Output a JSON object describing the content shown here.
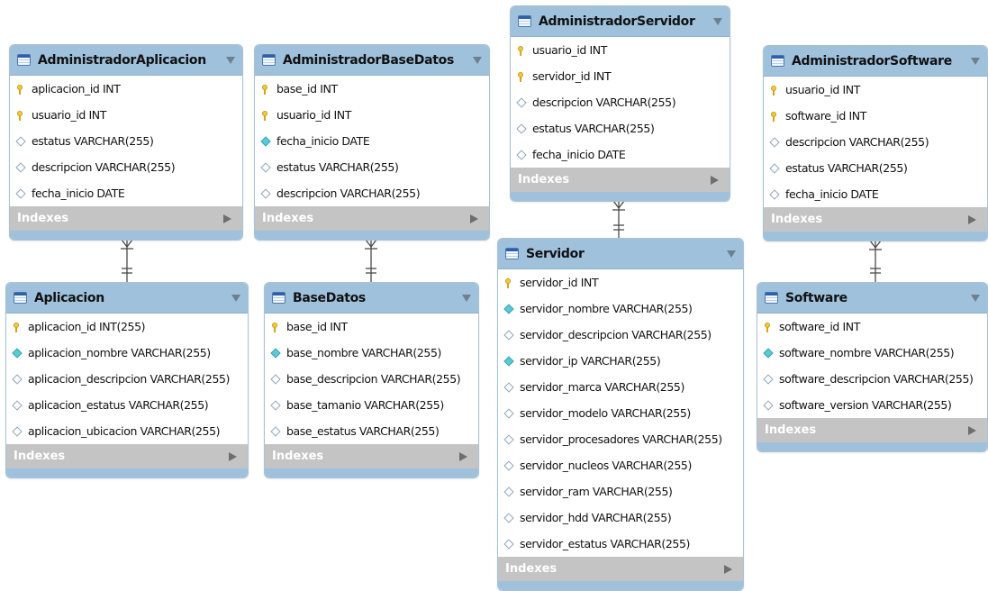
{
  "diagram": {
    "indexes_label": "Indexes",
    "colors": {
      "header": "#9fc1dc",
      "indexes_bar": "#c4c4c4",
      "pk_key": "#f2cc3a",
      "nn_diamond": "#5ec9d6",
      "connector": "#4a4a4a"
    },
    "tables": [
      {
        "name": "AdministradorAplicacion",
        "columns": [
          {
            "icon": "key-icon",
            "text": "aplicacion_id INT"
          },
          {
            "icon": "key-icon",
            "text": "usuario_id INT"
          },
          {
            "icon": "empty-diamond-icon",
            "text": "estatus VARCHAR(255)"
          },
          {
            "icon": "empty-diamond-icon",
            "text": "descripcion VARCHAR(255)"
          },
          {
            "icon": "empty-diamond-icon",
            "text": "fecha_inicio DATE"
          }
        ]
      },
      {
        "name": "AdministradorBaseDatos",
        "columns": [
          {
            "icon": "key-icon",
            "text": "base_id INT"
          },
          {
            "icon": "key-icon",
            "text": "usuario_id INT"
          },
          {
            "icon": "filled-diamond-icon",
            "text": "fecha_inicio DATE"
          },
          {
            "icon": "empty-diamond-icon",
            "text": "estatus VARCHAR(255)"
          },
          {
            "icon": "empty-diamond-icon",
            "text": "descripcion VARCHAR(255)"
          }
        ]
      },
      {
        "name": "AdministradorServidor",
        "columns": [
          {
            "icon": "key-icon",
            "text": "usuario_id INT"
          },
          {
            "icon": "key-icon",
            "text": "servidor_id INT"
          },
          {
            "icon": "empty-diamond-icon",
            "text": "descripcion VARCHAR(255)"
          },
          {
            "icon": "empty-diamond-icon",
            "text": "estatus VARCHAR(255)"
          },
          {
            "icon": "empty-diamond-icon",
            "text": "fecha_inicio DATE"
          }
        ]
      },
      {
        "name": "AdministradorSoftware",
        "columns": [
          {
            "icon": "key-icon",
            "text": "usuario_id INT"
          },
          {
            "icon": "key-icon",
            "text": "software_id INT"
          },
          {
            "icon": "empty-diamond-icon",
            "text": "descripcion VARCHAR(255)"
          },
          {
            "icon": "empty-diamond-icon",
            "text": "estatus VARCHAR(255)"
          },
          {
            "icon": "empty-diamond-icon",
            "text": "fecha_inicio DATE"
          }
        ]
      },
      {
        "name": "Aplicacion",
        "columns": [
          {
            "icon": "key-icon",
            "text": "aplicacion_id INT(255)"
          },
          {
            "icon": "filled-diamond-icon",
            "text": "aplicacion_nombre VARCHAR(255)"
          },
          {
            "icon": "empty-diamond-icon",
            "text": "aplicacion_descripcion VARCHAR(255)"
          },
          {
            "icon": "empty-diamond-icon",
            "text": "aplicacion_estatus VARCHAR(255)"
          },
          {
            "icon": "empty-diamond-icon",
            "text": "aplicacion_ubicacion VARCHAR(255)"
          }
        ]
      },
      {
        "name": "BaseDatos",
        "columns": [
          {
            "icon": "key-icon",
            "text": "base_id INT"
          },
          {
            "icon": "filled-diamond-icon",
            "text": "base_nombre VARCHAR(255)"
          },
          {
            "icon": "empty-diamond-icon",
            "text": "base_descripcion VARCHAR(255)"
          },
          {
            "icon": "empty-diamond-icon",
            "text": "base_tamanio VARCHAR(255)"
          },
          {
            "icon": "empty-diamond-icon",
            "text": "base_estatus VARCHAR(255)"
          }
        ]
      },
      {
        "name": "Servidor",
        "columns": [
          {
            "icon": "key-icon",
            "text": "servidor_id INT"
          },
          {
            "icon": "filled-diamond-icon",
            "text": "servidor_nombre VARCHAR(255)"
          },
          {
            "icon": "empty-diamond-icon",
            "text": "servidor_descripcion VARCHAR(255)"
          },
          {
            "icon": "filled-diamond-icon",
            "text": "servidor_ip VARCHAR(255)"
          },
          {
            "icon": "empty-diamond-icon",
            "text": "servidor_marca VARCHAR(255)"
          },
          {
            "icon": "empty-diamond-icon",
            "text": "servidor_modelo VARCHAR(255)"
          },
          {
            "icon": "empty-diamond-icon",
            "text": "servidor_procesadores VARCHAR(255)"
          },
          {
            "icon": "empty-diamond-icon",
            "text": "servidor_nucleos VARCHAR(255)"
          },
          {
            "icon": "empty-diamond-icon",
            "text": "servidor_ram VARCHAR(255)"
          },
          {
            "icon": "empty-diamond-icon",
            "text": "servidor_hdd VARCHAR(255)"
          },
          {
            "icon": "empty-diamond-icon",
            "text": "servidor_estatus VARCHAR(255)"
          }
        ]
      },
      {
        "name": "Software",
        "columns": [
          {
            "icon": "key-icon",
            "text": "software_id INT"
          },
          {
            "icon": "filled-diamond-icon",
            "text": "software_nombre VARCHAR(255)"
          },
          {
            "icon": "empty-diamond-icon",
            "text": "software_descripcion VARCHAR(255)"
          },
          {
            "icon": "empty-diamond-icon",
            "text": "software_version VARCHAR(255)"
          }
        ]
      }
    ],
    "relationships": [
      {
        "from": "AdministradorAplicacion",
        "to": "Aplicacion",
        "from_end": "many",
        "to_end": "one"
      },
      {
        "from": "AdministradorBaseDatos",
        "to": "BaseDatos",
        "from_end": "many",
        "to_end": "one"
      },
      {
        "from": "AdministradorServidor",
        "to": "Servidor",
        "from_end": "many",
        "to_end": "one"
      },
      {
        "from": "AdministradorSoftware",
        "to": "Software",
        "from_end": "many",
        "to_end": "one"
      }
    ]
  }
}
